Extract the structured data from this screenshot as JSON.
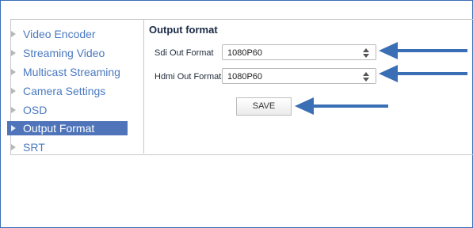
{
  "sidebar": {
    "items": [
      {
        "label": "Video Encoder"
      },
      {
        "label": "Streaming Video"
      },
      {
        "label": "Multicast Streaming"
      },
      {
        "label": "Camera Settings"
      },
      {
        "label": "OSD"
      },
      {
        "label": "Output Format",
        "active": true
      },
      {
        "label": "SRT"
      }
    ]
  },
  "main": {
    "heading": "Output format",
    "sdi": {
      "label": "Sdi Out Format",
      "value": "1080P60"
    },
    "hdmi": {
      "label": "Hdmi Out Format",
      "value": "1080P60"
    },
    "save_label": "SAVE"
  },
  "colors": {
    "accent": "#4f74b9",
    "link": "#4a79c0",
    "annotation_arrow": "#3a6fb5",
    "frame_border": "#3a6fb5"
  }
}
